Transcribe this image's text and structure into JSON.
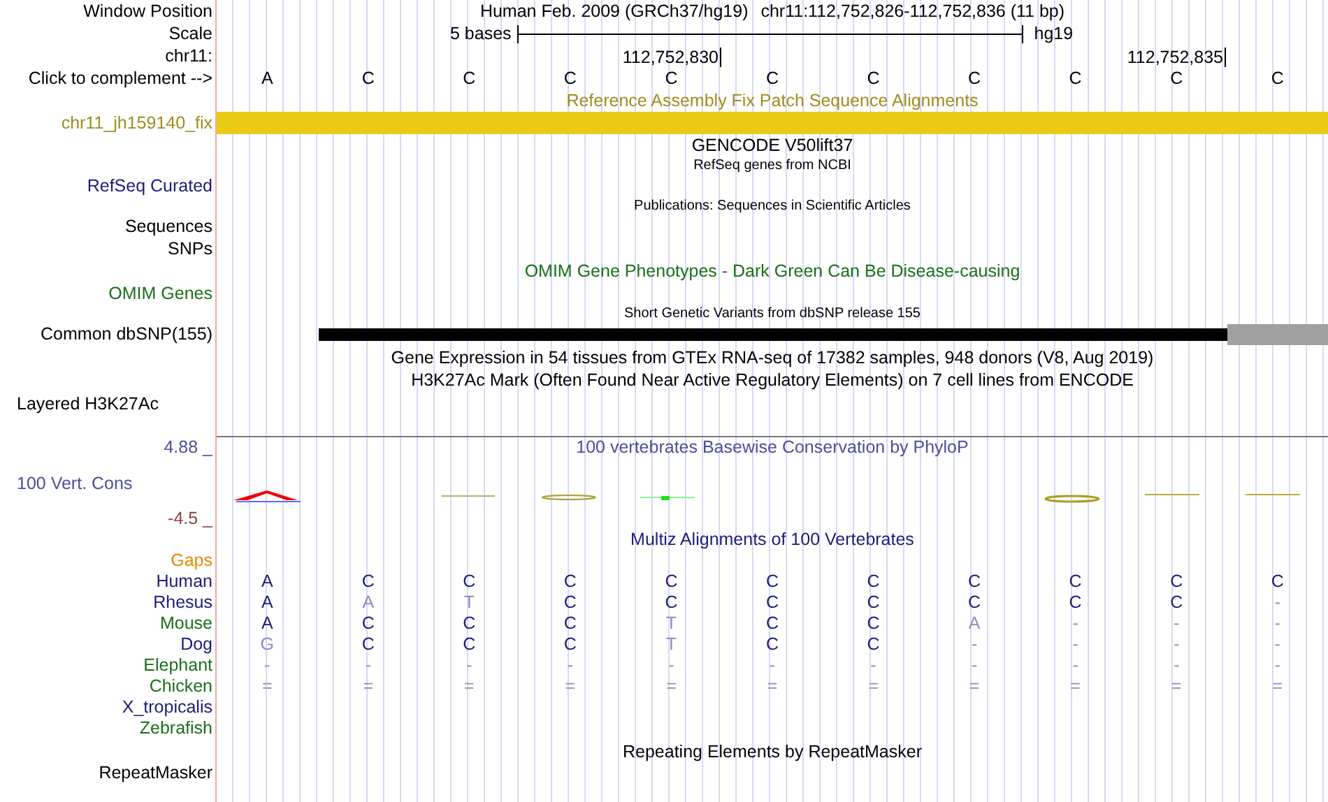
{
  "header": {
    "window_label": "Window Position",
    "title": "Human Feb. 2009 (GRCh37/hg19)",
    "position": "chr11:112,752,826-112,752,836 (11 bp)",
    "scale_label": "Scale",
    "scale_text": "5 bases",
    "assembly": "hg19",
    "chrom_label": "chr11:",
    "ticks": [
      "112,752,830",
      "112,752,835"
    ],
    "complement_label": "Click to complement -->",
    "bases": [
      "A",
      "C",
      "C",
      "C",
      "C",
      "C",
      "C",
      "C",
      "C",
      "C",
      "C"
    ]
  },
  "rows": [
    {
      "kind": "caption",
      "text": "Reference Assembly Fix Patch Sequence Alignments",
      "color": "#a08c1e"
    },
    {
      "kind": "bar",
      "label": "chr11_jh159140_fix",
      "color": "#a08c1e"
    },
    {
      "kind": "caption",
      "text": "GENCODE V50lift37",
      "color": "#000000"
    },
    {
      "kind": "small",
      "text": "RefSeq genes from NCBI",
      "color": "#000000"
    },
    {
      "kind": "label",
      "label": "RefSeq Curated",
      "color": "#1c1c78"
    },
    {
      "kind": "small",
      "text": "Publications: Sequences in Scientific Articles",
      "color": "#000000"
    },
    {
      "kind": "label",
      "label": "Sequences",
      "color": "#000000"
    },
    {
      "kind": "label",
      "label": "SNPs",
      "color": "#000000"
    },
    {
      "kind": "caption",
      "text": "OMIM Gene Phenotypes - Dark Green Can Be Disease-causing",
      "color": "#1a6e1a"
    },
    {
      "kind": "label",
      "label": "OMIM Genes",
      "color": "#1a6e1a"
    },
    {
      "kind": "small",
      "text": "Short Genetic Variants from dbSNP release 155",
      "color": "#000000"
    },
    {
      "kind": "snp",
      "label": "Common dbSNP(155)",
      "color": "#000000"
    },
    {
      "kind": "caption",
      "text": "Gene Expression in 54 tissues from GTEx RNA-seq of 17382 samples, 948 donors (V8, Aug 2019)",
      "color": "#000000"
    },
    {
      "kind": "caption",
      "text": "H3K27Ac Mark (Often Found Near Active Regulatory Elements) on 7 cell lines from ENCODE",
      "color": "#000000"
    },
    {
      "kind": "group_label",
      "label": "Layered H3K27Ac",
      "color": "#000000"
    }
  ],
  "conservation": {
    "max": "4.88 _",
    "title": "100 vertebrates Basewise Conservation by PhyloP",
    "label": "100 Vert. Cons",
    "min": "-4.5 _"
  },
  "multiz": {
    "title": "Multiz Alignments of 100 Vertebrates",
    "gaps_label": "Gaps",
    "species": [
      {
        "name": "Human",
        "color": "#1c1c78",
        "bases": [
          {
            "base": "A",
            "faded": false
          },
          {
            "base": "C",
            "faded": false
          },
          {
            "base": "C",
            "faded": false
          },
          {
            "base": "C",
            "faded": false
          },
          {
            "base": "C",
            "faded": false
          },
          {
            "base": "C",
            "faded": false
          },
          {
            "base": "C",
            "faded": false
          },
          {
            "base": "C",
            "faded": false
          },
          {
            "base": "C",
            "faded": false
          },
          {
            "base": "C",
            "faded": false
          },
          {
            "base": "C",
            "faded": false
          }
        ]
      },
      {
        "name": "Rhesus",
        "color": "#1c1c78",
        "bases": [
          {
            "base": "A",
            "faded": false
          },
          {
            "base": "A",
            "faded": true
          },
          {
            "base": "T",
            "faded": true
          },
          {
            "base": "C",
            "faded": false
          },
          {
            "base": "C",
            "faded": false
          },
          {
            "base": "C",
            "faded": false
          },
          {
            "base": "C",
            "faded": false
          },
          {
            "base": "C",
            "faded": false
          },
          {
            "base": "C",
            "faded": false
          },
          {
            "base": "C",
            "faded": false
          },
          {
            "base": "-",
            "faded": true
          }
        ]
      },
      {
        "name": "Mouse",
        "color": "#1a6e1a",
        "bases": [
          {
            "base": "A",
            "faded": false
          },
          {
            "base": "C",
            "faded": false
          },
          {
            "base": "C",
            "faded": false
          },
          {
            "base": "C",
            "faded": false
          },
          {
            "base": "T",
            "faded": true
          },
          {
            "base": "C",
            "faded": false
          },
          {
            "base": "C",
            "faded": false
          },
          {
            "base": "A",
            "faded": true
          },
          {
            "base": "-",
            "faded": true
          },
          {
            "base": "-",
            "faded": true
          },
          {
            "base": "-",
            "faded": true
          }
        ]
      },
      {
        "name": "Dog",
        "color": "#1c1c78",
        "bases": [
          {
            "base": "G",
            "faded": true
          },
          {
            "base": "C",
            "faded": false
          },
          {
            "base": "C",
            "faded": false
          },
          {
            "base": "C",
            "faded": false
          },
          {
            "base": "T",
            "faded": true
          },
          {
            "base": "C",
            "faded": false
          },
          {
            "base": "C",
            "faded": false
          },
          {
            "base": "-",
            "faded": true
          },
          {
            "base": "-",
            "faded": true
          },
          {
            "base": "-",
            "faded": true
          },
          {
            "base": "-",
            "faded": true
          }
        ]
      },
      {
        "name": "Elephant",
        "color": "#1a6e1a",
        "bases": [
          {
            "base": "-",
            "faded": true
          },
          {
            "base": "-",
            "faded": true
          },
          {
            "base": "-",
            "faded": true
          },
          {
            "base": "-",
            "faded": true
          },
          {
            "base": "-",
            "faded": true
          },
          {
            "base": "-",
            "faded": true
          },
          {
            "base": "-",
            "faded": true
          },
          {
            "base": "-",
            "faded": true
          },
          {
            "base": "-",
            "faded": true
          },
          {
            "base": "-",
            "faded": true
          },
          {
            "base": "-",
            "faded": true
          }
        ]
      },
      {
        "name": "Chicken",
        "color": "#1a6e1a",
        "bases": [
          {
            "base": "=",
            "faded": true
          },
          {
            "base": "=",
            "faded": true
          },
          {
            "base": "=",
            "faded": true
          },
          {
            "base": "=",
            "faded": true
          },
          {
            "base": "=",
            "faded": true
          },
          {
            "base": "=",
            "faded": true
          },
          {
            "base": "=",
            "faded": true
          },
          {
            "base": "=",
            "faded": true
          },
          {
            "base": "=",
            "faded": true
          },
          {
            "base": "=",
            "faded": true
          },
          {
            "base": "=",
            "faded": true
          }
        ]
      },
      {
        "name": "X_tropicalis",
        "color": "#1c1c78"
      },
      {
        "name": "Zebrafish",
        "color": "#1a6e1a"
      }
    ]
  },
  "repeatmasker": {
    "title": "Repeating Elements by RepeatMasker",
    "label": "RepeatMasker"
  }
}
